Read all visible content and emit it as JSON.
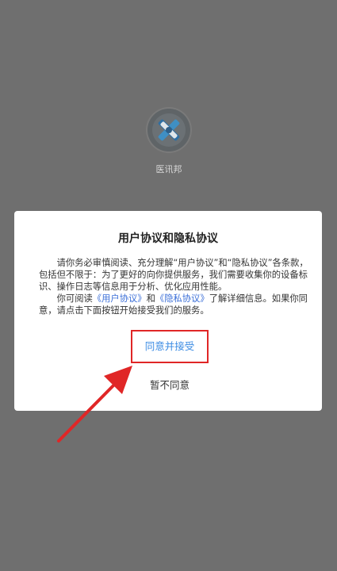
{
  "app": {
    "name": "医讯邦",
    "icon": "app-logo-icon"
  },
  "dialog": {
    "title": "用户协议和隐私协议",
    "paragraph1": "请你务必审慎阅读、充分理解“用户协议”和“隐私协议”各条款，包括但不限于：为了更好的向你提供服务，我们需要收集你的设备标识、操作日志等信息用于分析、优化应用性能。",
    "paragraph2_prefix": "你可阅读",
    "user_agreement_link": "《用户协议》",
    "paragraph2_and": "和",
    "privacy_link": "《隐私协议》",
    "paragraph2_suffix": "了解详细信息。如果你同意，请点击下面按钮开始接受我们的服务。",
    "accept_label": "同意并接受",
    "decline_label": "暂不同意"
  },
  "colors": {
    "overlay": "#6f6f6f",
    "link": "#3b6fd8",
    "accept_text": "#3b8be3",
    "highlight": "#e02626"
  }
}
